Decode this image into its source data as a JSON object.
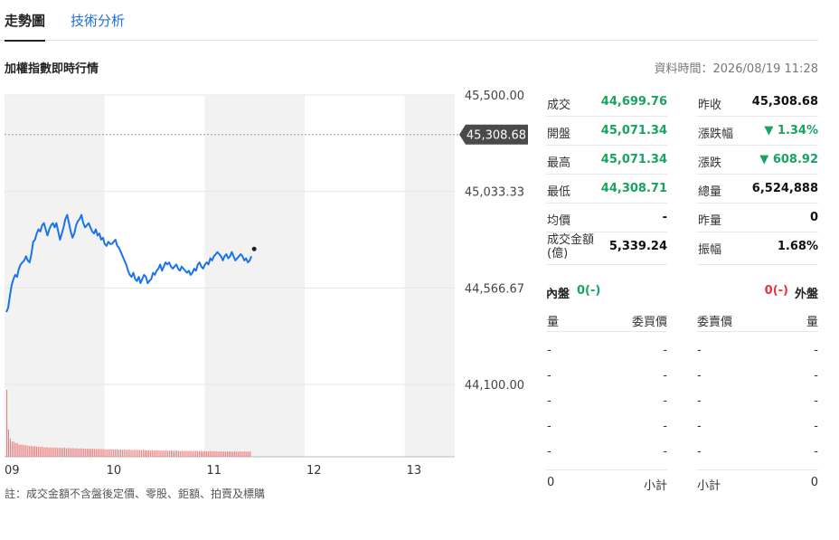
{
  "tabs": [
    {
      "label": "走勢圖",
      "active": true
    },
    {
      "label": "技術分析",
      "active": false
    }
  ],
  "header": {
    "title": "加權指數即時行情",
    "data_time": "資料時間：2026/08/19 11:28"
  },
  "chart_data": {
    "type": "line",
    "x_tick_labels": [
      "09",
      "10",
      "11",
      "12",
      "13"
    ],
    "y_tick_labels": [
      "45,500.00",
      "45,033.33",
      "44,566.67",
      "44,100.00"
    ],
    "ylim": [
      44100,
      45500
    ],
    "reference_label": "45,308.68",
    "reference_value": 45308.68,
    "line_color": "#1a73e8",
    "volume_color": "#f07a7a",
    "x_hours": [
      9,
      13
    ],
    "series": [
      {
        "values": [
          44450,
          44470,
          44530,
          44580,
          44610,
          44630,
          44620,
          44660,
          44680,
          44690,
          44700,
          44720,
          44700,
          44690,
          44730,
          44790,
          44800,
          44830,
          44850,
          44840,
          44870,
          44880,
          44850,
          44820,
          44850,
          44870,
          44880,
          44860,
          44880,
          44840,
          44800,
          44830,
          44860,
          44900,
          44920,
          44880,
          44840,
          44810,
          44830,
          44870,
          44890,
          44900,
          44920,
          44880,
          44860,
          44870,
          44880,
          44860,
          44840,
          44830,
          44850,
          44820,
          44830,
          44800,
          44810,
          44780,
          44770,
          44790,
          44780,
          44780,
          44790,
          44800,
          44770,
          44760,
          44740,
          44720,
          44700,
          44680,
          44650,
          44630,
          44620,
          44640,
          44610,
          44600,
          44620,
          44590,
          44610,
          44630,
          44620,
          44590,
          44600,
          44610,
          44640,
          44630,
          44650,
          44660,
          44680,
          44650,
          44670,
          44690,
          44680,
          44690,
          44670,
          44660,
          44670,
          44680,
          44660,
          44650,
          44670,
          44660,
          44650,
          44640,
          44650,
          44630,
          44640,
          44660,
          44650,
          44680,
          44690,
          44670,
          44660,
          44680,
          44690,
          44680,
          44710,
          44700,
          44720,
          44730,
          44740,
          44730,
          44720,
          44700,
          44720,
          44730,
          44710,
          44720,
          44740,
          44720,
          44700,
          44710,
          44720,
          44730,
          44720,
          44700,
          44710,
          44690,
          44700,
          44720
        ]
      }
    ],
    "volume": [
      22,
      9,
      6,
      5,
      5,
      4.5,
      4.5,
      4,
      4,
      4,
      3.8,
      3.8,
      3.6,
      3.5,
      3.6,
      3.4,
      3.5,
      3.3,
      3.4,
      3.2,
      3.3,
      3.2,
      3.1,
      3.2,
      3,
      3.1,
      3,
      3,
      3.1,
      2.9,
      3,
      2.9,
      2.9,
      3,
      2.8,
      2.9,
      2.8,
      2.8,
      2.9,
      2.7,
      2.8,
      2.7,
      2.8,
      2.7,
      2.7,
      2.6,
      2.7,
      2.6,
      2.6,
      2.7,
      2.6,
      2.5,
      2.6,
      2.5,
      2.6,
      2.5,
      2.5,
      2.4,
      2.5,
      2.4,
      2.5,
      2.4,
      2.4,
      2.5,
      2.3,
      2.4,
      2.3,
      2.4,
      2.3,
      2.3,
      2.4,
      2.3,
      2.2,
      2.3,
      2.2,
      2.3,
      2.2,
      2.2,
      2.3,
      2.2,
      2.1,
      2.2,
      2.1,
      2.2,
      2.1,
      2.1,
      2.2,
      2.1,
      2,
      2.1,
      2,
      2.1,
      2,
      2,
      2.1,
      2,
      2,
      2.1,
      2,
      1.9,
      2,
      1.9,
      2,
      1.9,
      1.9,
      2,
      1.9,
      1.9,
      2,
      1.9,
      1.8,
      1.9,
      1.8,
      1.9,
      1.8,
      1.8,
      1.9,
      1.8,
      1.8,
      1.9,
      1.8,
      1.7,
      1.8,
      1.7,
      1.8,
      1.7,
      1.7,
      1.8,
      1.7,
      1.7,
      1.8,
      1.7,
      1.7,
      1.8,
      1.7,
      1.7,
      1.8,
      1.7,
      1.7,
      1.8
    ]
  },
  "quote": {
    "rows": [
      {
        "left_label": "成交",
        "left_value": "44,699.76",
        "left_color": "green",
        "right_label": "昨收",
        "right_value": "45,308.68",
        "right_color": "dark"
      },
      {
        "left_label": "開盤",
        "left_value": "45,071.34",
        "left_color": "green",
        "right_label": "漲跌幅",
        "right_value": "▼ 1.34%",
        "right_color": "green"
      },
      {
        "left_label": "最高",
        "left_value": "45,071.34",
        "left_color": "green",
        "right_label": "漲跌",
        "right_value": "▼ 608.92",
        "right_color": "green"
      },
      {
        "left_label": "最低",
        "left_value": "44,308.71",
        "left_color": "green",
        "right_label": "總量",
        "right_value": "6,524,888",
        "right_color": "dark"
      },
      {
        "left_label": "均價",
        "left_value": "-",
        "left_color": "dark",
        "right_label": "昨量",
        "right_value": "0",
        "right_color": "dark"
      },
      {
        "left_label": "成交金額\n(億)",
        "left_value": "5,339.24",
        "left_color": "dark",
        "right_label": "振幅",
        "right_value": "1.68%",
        "right_color": "dark"
      }
    ]
  },
  "inout": {
    "in_label": "內盤",
    "in_value": "0(-)",
    "out_value": "0(-)",
    "out_label": "外盤"
  },
  "orderbook": {
    "bid_head_qty": "量",
    "bid_head_price": "委買價",
    "ask_head_price": "委賣價",
    "ask_head_qty": "量",
    "rows": [
      {
        "bid_qty": "-",
        "bid_price": "-",
        "ask_price": "-",
        "ask_qty": "-"
      },
      {
        "bid_qty": "-",
        "bid_price": "-",
        "ask_price": "-",
        "ask_qty": "-"
      },
      {
        "bid_qty": "-",
        "bid_price": "-",
        "ask_price": "-",
        "ask_qty": "-"
      },
      {
        "bid_qty": "-",
        "bid_price": "-",
        "ask_price": "-",
        "ask_qty": "-"
      },
      {
        "bid_qty": "-",
        "bid_price": "-",
        "ask_price": "-",
        "ask_qty": "-"
      }
    ],
    "bid_total_qty": "0",
    "bid_total_label": "小計",
    "ask_total_label": "小計",
    "ask_total_qty": "0"
  },
  "footnote": "註：成交金額不含盤後定價、零股、鉅額、拍賣及標購"
}
